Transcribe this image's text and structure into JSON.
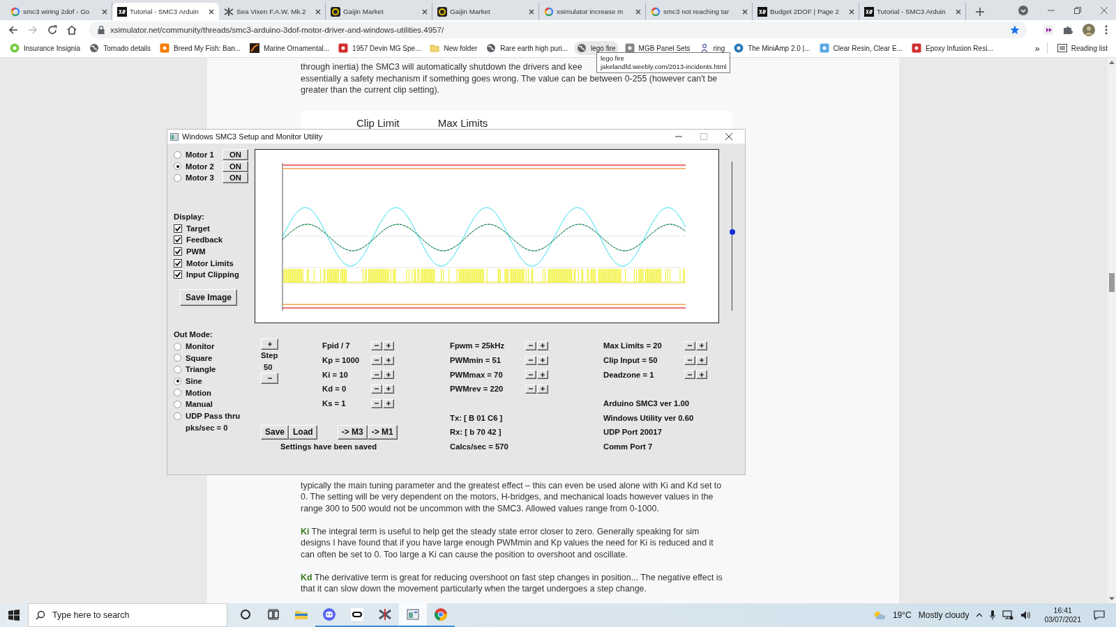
{
  "browser": {
    "tabs": [
      {
        "title": "smc3 wiring 2dof - Go",
        "kind": "google",
        "selected": false
      },
      {
        "title": "Tutorial - SMC3 Arduin",
        "kind": "xs",
        "selected": true
      },
      {
        "title": "Sea Vixen F.A.W. Mk.2",
        "kind": "plane",
        "selected": false
      },
      {
        "title": "Gaijin Market",
        "kind": "gaijin",
        "selected": false
      },
      {
        "title": "Gaijin Market",
        "kind": "gaijin",
        "selected": false
      },
      {
        "title": "xsimulator increase m",
        "kind": "google",
        "selected": false
      },
      {
        "title": "smc3 not reaching tar",
        "kind": "google",
        "selected": false
      },
      {
        "title": "Budget 2DOF | Page 2",
        "kind": "xs",
        "selected": false
      },
      {
        "title": "Tutorial - SMC3 Arduin",
        "kind": "xs",
        "selected": false
      }
    ],
    "forward_disabled": true,
    "address": "xsimulator.net/community/threads/smc3-arduino-3dof-motor-driver-and-windows-utilities.4957/",
    "bookmarks": [
      {
        "label": "Insurance Insignia",
        "kind": "green",
        "hovered": false
      },
      {
        "label": "Tornado details",
        "kind": "globe",
        "hovered": false
      },
      {
        "label": "Breed My Fish: Ban...",
        "kind": "orange",
        "hovered": false
      },
      {
        "label": "Marine Ornamental...",
        "kind": "photo",
        "hovered": false
      },
      {
        "label": "1957 Devin MG Spe...",
        "kind": "red",
        "hovered": false
      },
      {
        "label": "New folder",
        "kind": "folder",
        "hovered": false
      },
      {
        "label": "Rare earth high puri...",
        "kind": "globe",
        "hovered": false
      },
      {
        "label": "lego fire",
        "kind": "globe",
        "hovered": true
      },
      {
        "label": "MGB Panel Sets",
        "kind": "gray",
        "hovered": false
      },
      {
        "label": "ring",
        "kind": "person",
        "hovered": false
      },
      {
        "label": "The MiniAmp 2.0 |...",
        "kind": "blue",
        "hovered": false
      },
      {
        "label": "Clear Resin, Clear E...",
        "kind": "cyan",
        "hovered": false
      },
      {
        "label": "Epoxy Infusion Resi...",
        "kind": "red",
        "hovered": false
      }
    ],
    "more": "»",
    "reading_list": "Reading list",
    "tooltip": {
      "title": "lego fire",
      "url": "jakelandfd.weebly.com/2013-incidents.html"
    }
  },
  "article": {
    "intro_lines": [
      "through inertia) the SMC3 will automatically shutdown the drivers and kee",
      "essentially a safety mechanism if something goes wrong. The value can be between 0-255 (however can't be",
      "greater than the current clip setting)."
    ],
    "figure_labels": [
      "Clip Limit",
      "Max Limits"
    ],
    "paragraphs": [
      "typically the main tuning parameter and the greatest effect – this can even be used alone with Ki and Kd set to 0. The setting will be very dependent on the motors, H-bridges, and mechanical loads however values in the range 300 to 500 would not be uncommon with the SMC3. Allowed values range from 0-1000.",
      "**Ki** The integral term is useful to help get the steady state error closer to zero. Generally speaking for sim designs I have found that if you have large enough PWMmin and Kp values the need for Ki is reduced and it can often be set to 0. Too large a Ki can cause the position to overshoot and oscillate.",
      "**Kd** The derivative term is great for reducing overshoot on fast step changes in position... The negative effect is that it can slow down the movement particularly when the target undergoes a step change."
    ]
  },
  "app": {
    "title": "Windows SMC3 Setup and Monitor Utility",
    "motors": [
      {
        "label": "Motor 1",
        "selected": false,
        "button": "ON"
      },
      {
        "label": "Motor 2",
        "selected": true,
        "button": "ON"
      },
      {
        "label": "Motor 3",
        "selected": false,
        "button": "ON"
      }
    ],
    "display": {
      "heading": "Display:",
      "options": [
        {
          "label": "Target",
          "checked": true
        },
        {
          "label": "Feedback",
          "checked": true
        },
        {
          "label": "PWM",
          "checked": true
        },
        {
          "label": "Motor Limits",
          "checked": true
        },
        {
          "label": "Input Clipping",
          "checked": true
        }
      ]
    },
    "save_image": "Save Image",
    "slider": {
      "level": 0.53
    },
    "out_mode": {
      "heading": "Out Mode:",
      "options": [
        {
          "label": "Monitor",
          "selected": false
        },
        {
          "label": "Square",
          "selected": false
        },
        {
          "label": "Triangle",
          "selected": false
        },
        {
          "label": "Sine",
          "selected": true
        },
        {
          "label": "Motion",
          "selected": false
        },
        {
          "label": "Manual",
          "selected": false
        },
        {
          "label": "UDP Pass thru",
          "selected": false
        }
      ],
      "rate": "pks/sec = 0"
    },
    "step": {
      "label": "Step",
      "value": "50"
    },
    "pid": [
      "Fpid / 7",
      "Kp = 1000",
      "Ki = 10",
      "Kd = 0",
      "Ks = 1"
    ],
    "pwm": [
      "Fpwm = 25kHz",
      "PWMmin = 51",
      "PWMmax = 70",
      "PWMrev = 220"
    ],
    "limits": [
      "Max Limits = 20",
      "Clip Input = 50",
      "Deadzone = 1"
    ],
    "link": [
      "Tx: [ B 01 C6 ]",
      "Rx: [ b 70 42 ]",
      "Calcs/sec = 570"
    ],
    "versions": [
      "Arduino SMC3 ver 1.00",
      "Windows Utility ver 0.60",
      "UDP Port 20017",
      "Comm Port 7"
    ],
    "buttons": {
      "save": "Save",
      "load": "Load",
      "to_m3": "-> M3",
      "to_m1": "-> M1"
    },
    "status": "Settings have been saved"
  },
  "taskbar": {
    "search": {
      "placeholder": "Type here to search"
    },
    "apps": [
      {
        "kind": "cortana",
        "running": false,
        "active": false
      },
      {
        "kind": "taskview",
        "running": false,
        "active": false
      },
      {
        "kind": "explorer",
        "running": false,
        "active": false
      },
      {
        "kind": "discord",
        "running": true,
        "active": false
      },
      {
        "kind": "oculus",
        "running": true,
        "active": false
      },
      {
        "kind": "plane",
        "running": true,
        "active": false
      },
      {
        "kind": "window",
        "running": true,
        "active": true
      },
      {
        "kind": "chrome",
        "running": true,
        "active": false
      }
    ],
    "weather": {
      "temp": "19°C",
      "condition": "Mostly cloudy"
    },
    "time": "16:41",
    "date": "03/07/2021"
  }
}
